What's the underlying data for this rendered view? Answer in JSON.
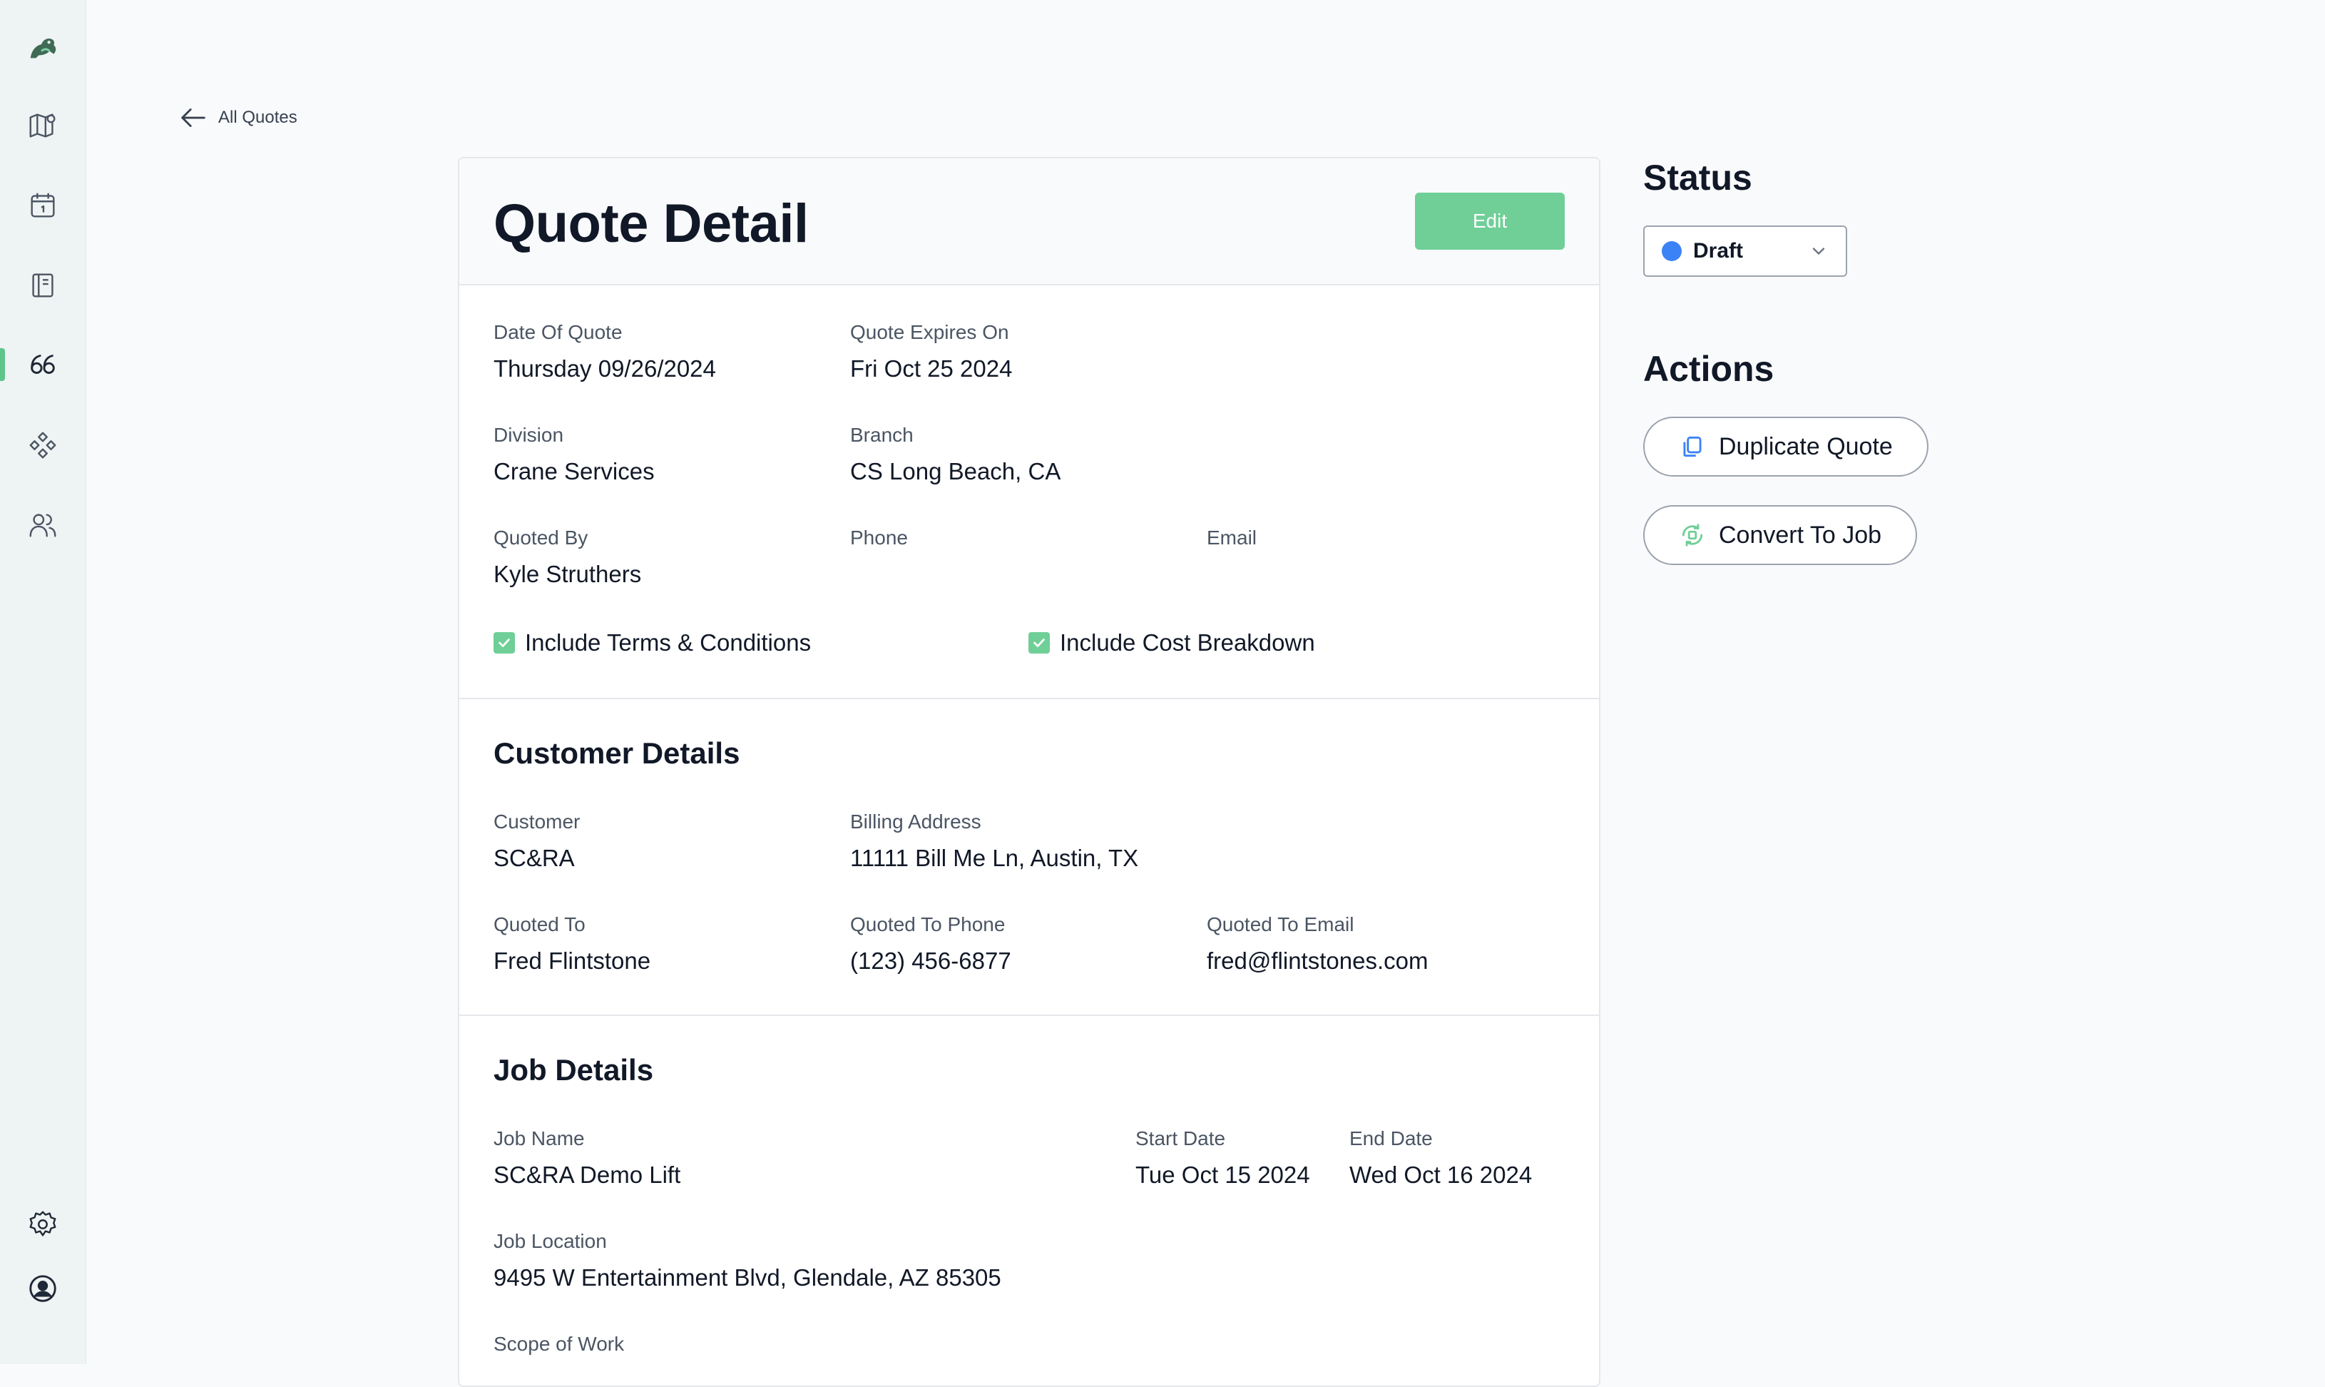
{
  "nav": {
    "back_label": "All Quotes"
  },
  "header": {
    "title": "Quote Detail",
    "edit_label": "Edit"
  },
  "quote": {
    "date_label": "Date Of Quote",
    "date_value": "Thursday 09/26/2024",
    "expires_label": "Quote Expires On",
    "expires_value": "Fri Oct 25 2024",
    "division_label": "Division",
    "division_value": "Crane Services",
    "branch_label": "Branch",
    "branch_value": "CS Long Beach, CA",
    "quoted_by_label": "Quoted By",
    "quoted_by_value": "Kyle Struthers",
    "phone_label": "Phone",
    "email_label": "Email",
    "terms_label": "Include Terms & Conditions",
    "cost_label": "Include Cost Breakdown"
  },
  "customer": {
    "title": "Customer Details",
    "customer_label": "Customer",
    "customer_value": "SC&RA",
    "billing_label": "Billing Address",
    "billing_value": "11111 Bill Me Ln, Austin, TX",
    "quoted_to_label": "Quoted To",
    "quoted_to_value": "Fred Flintstone",
    "quoted_phone_label": "Quoted To Phone",
    "quoted_phone_value": "(123) 456-6877",
    "quoted_email_label": "Quoted To Email",
    "quoted_email_value": "fred@flintstones.com"
  },
  "job": {
    "title": "Job Details",
    "name_label": "Job Name",
    "name_value": "SC&RA Demo Lift",
    "start_label": "Start Date",
    "start_value": "Tue Oct 15 2024",
    "end_label": "End Date",
    "end_value": "Wed Oct 16 2024",
    "location_label": "Job Location",
    "location_value": "9495 W Entertainment Blvd, Glendale, AZ 85305",
    "scope_label": "Scope of Work"
  },
  "status": {
    "title": "Status",
    "selected": "Draft",
    "dot_color": "#3b82f6"
  },
  "actions": {
    "title": "Actions",
    "duplicate_label": "Duplicate Quote",
    "convert_label": "Convert To Job"
  },
  "colors": {
    "accent": "#6fcf97",
    "sidebar_bg": "#eef3f3"
  }
}
